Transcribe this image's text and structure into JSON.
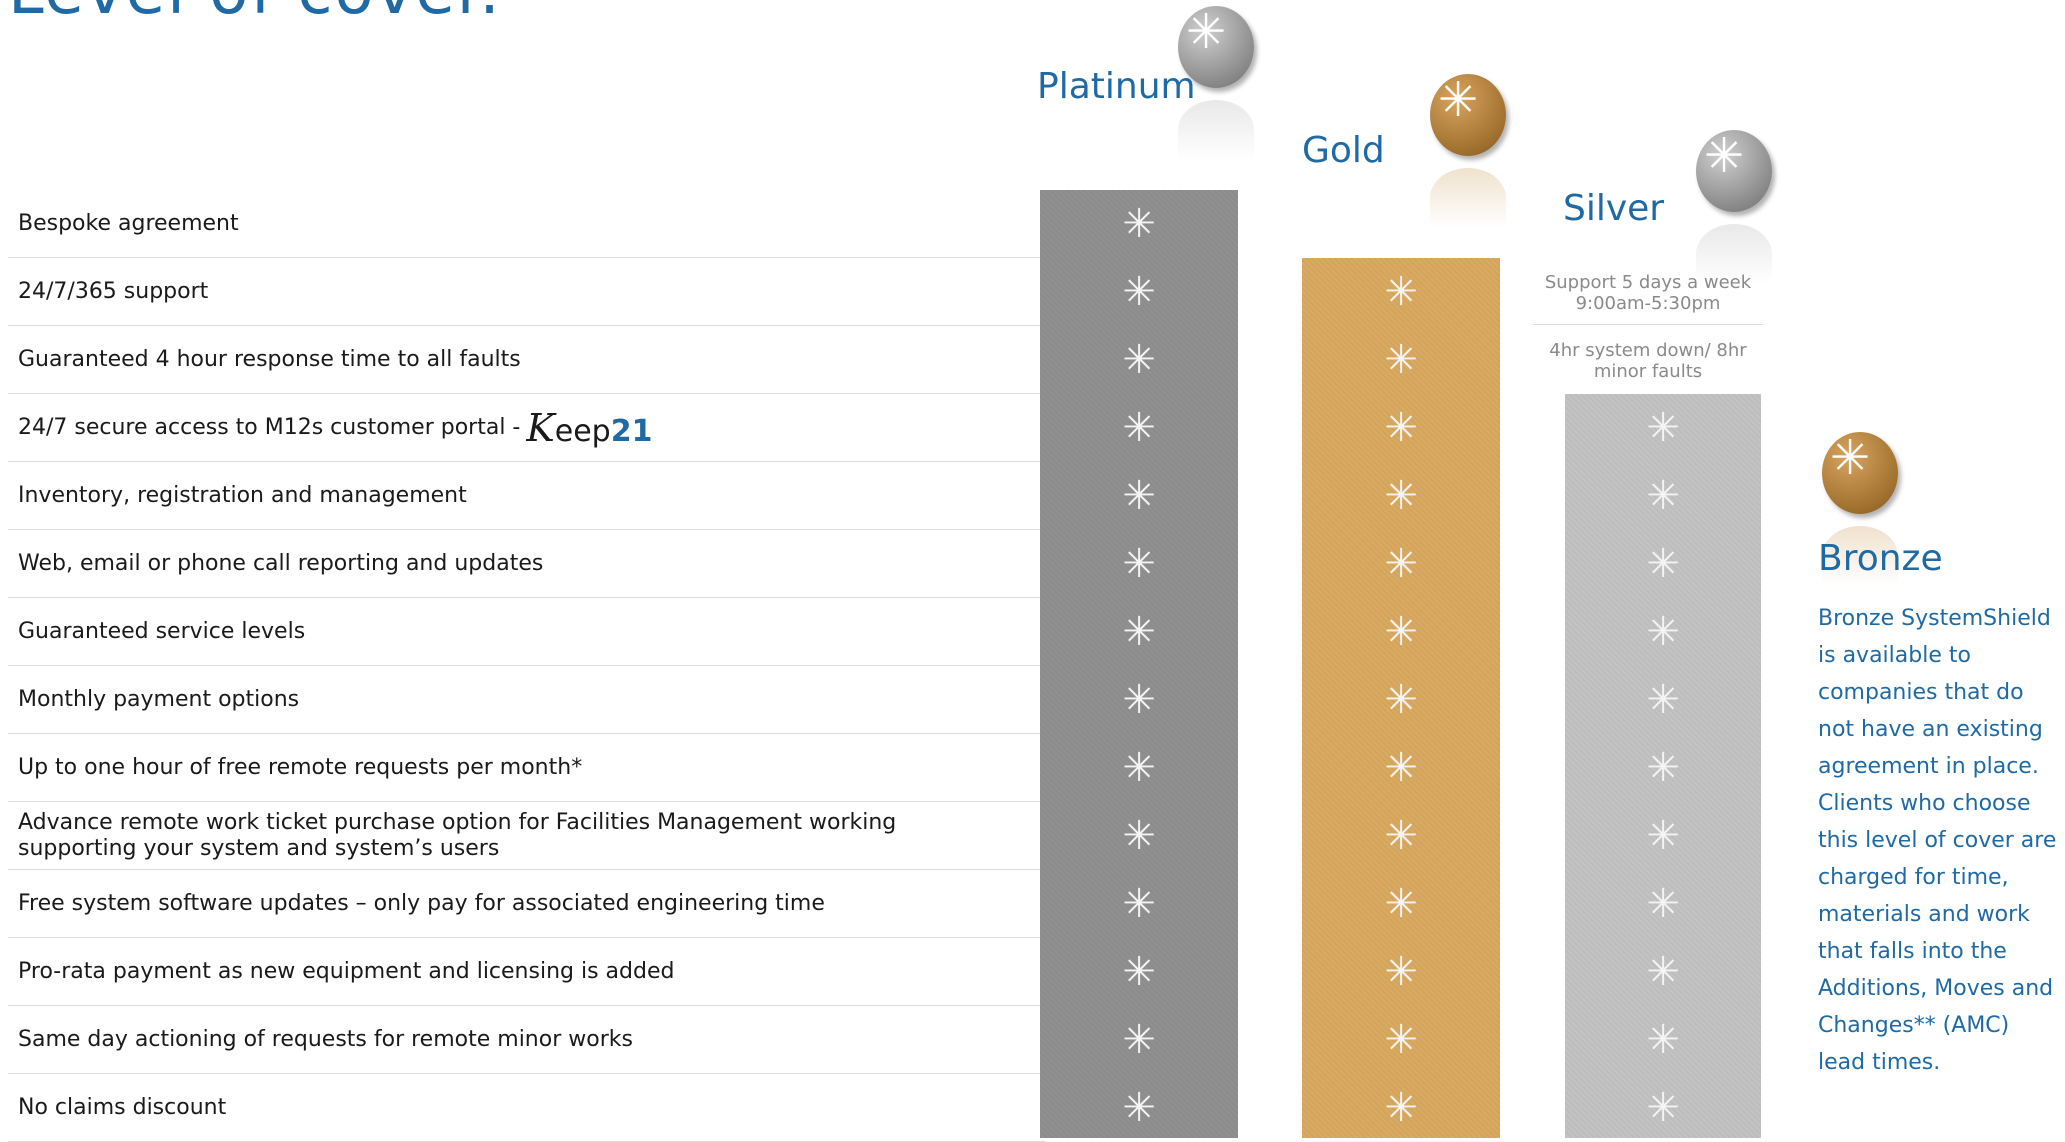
{
  "title": "Level of cover.",
  "tiers": {
    "platinum": "Platinum",
    "gold": "Gold",
    "silver": "Silver",
    "bronze": "Bronze"
  },
  "silver_notes": {
    "support": "Support 5 days a week 9:00am-5:30pm",
    "response": "4hr system down/ 8hr minor faults"
  },
  "features": [
    "Bespoke agreement",
    "24/7/365 support",
    "Guaranteed 4 hour response time to all faults",
    "24/7 secure access to M12s customer portal -",
    "Inventory, registration and management",
    "Web, email or phone call reporting and updates",
    "Guaranteed service levels",
    "Monthly payment options",
    "Up to one hour of free remote requests per month*",
    "Advance remote work ticket purchase option for Facilities Management working supporting your system and system’s users",
    "Free system software updates – only pay for associated engineering time",
    "Pro-rata payment as new equipment and licensing is added",
    "Same day actioning of requests for remote minor works",
    "No claims discount"
  ],
  "logo": {
    "k": "K",
    "eep": "eep",
    "num": "21"
  },
  "bronze_description": "Bronze SystemShield is available to companies that do not have an existing agreement in place. Clients who choose this level of cover are charged for time, materials and work that falls into the Additions, Moves and Changes** (AMC) lead times.",
  "star_glyph": "✳",
  "colors": {
    "heading": "#1f6aa5",
    "platinum": "#8e8e8e",
    "gold": "#d6a760",
    "silver": "#c0c0c0"
  }
}
